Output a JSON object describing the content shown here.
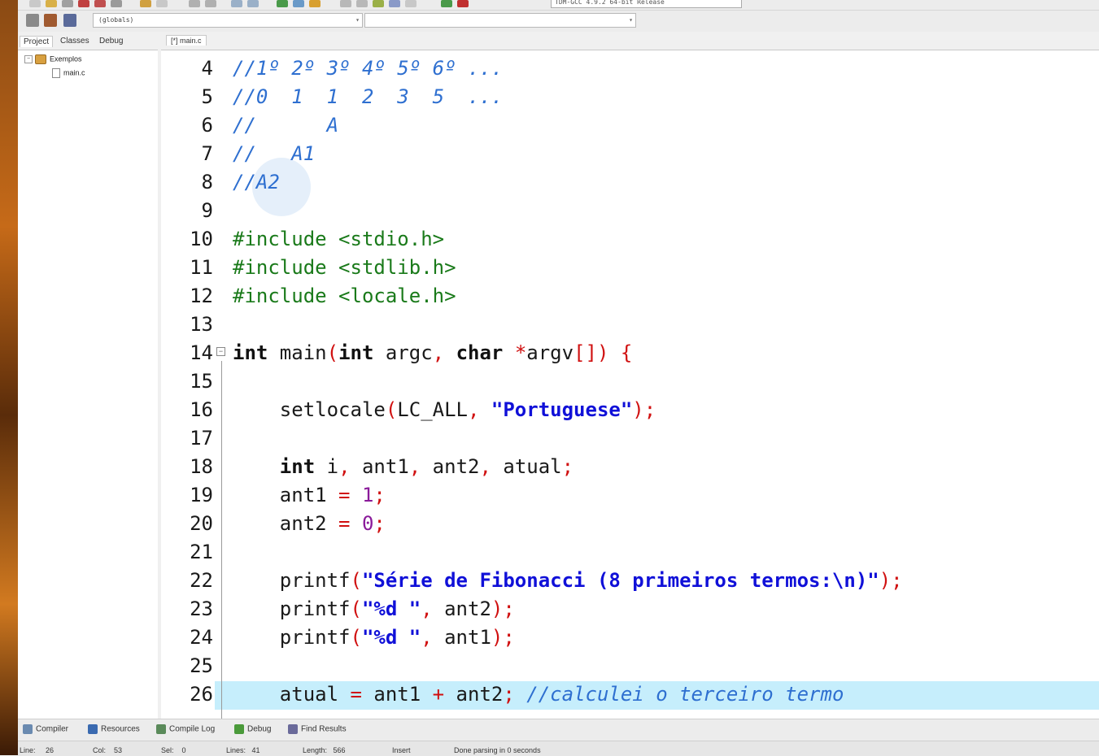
{
  "toolbar": {
    "compiler_combo": "TDM-GCC 4.9.2 64-bit Release",
    "globals_combo": "(globals)",
    "member_combo": ""
  },
  "project_panel": {
    "tabs": [
      "Project",
      "Classes",
      "Debug"
    ],
    "tree": {
      "project": "Exemplos",
      "file": "main.c"
    }
  },
  "editor": {
    "tab_label": "[*] main.c",
    "lines": [
      {
        "no": "4",
        "tokens": [
          {
            "c": "cmt",
            "t": "//1º 2º 3º 4º 5º 6º ..."
          }
        ]
      },
      {
        "no": "5",
        "tokens": [
          {
            "c": "cmt",
            "t": "//0  1  1  2  3  5  ..."
          }
        ]
      },
      {
        "no": "6",
        "tokens": [
          {
            "c": "cmt",
            "t": "//      A"
          }
        ]
      },
      {
        "no": "7",
        "tokens": [
          {
            "c": "cmt",
            "t": "//   A1"
          }
        ]
      },
      {
        "no": "8",
        "tokens": [
          {
            "c": "cmt",
            "t": "//A2"
          }
        ]
      },
      {
        "no": "9",
        "tokens": []
      },
      {
        "no": "10",
        "tokens": [
          {
            "c": "pp",
            "t": "#include <stdio.h>"
          }
        ]
      },
      {
        "no": "11",
        "tokens": [
          {
            "c": "pp",
            "t": "#include <stdlib.h>"
          }
        ]
      },
      {
        "no": "12",
        "tokens": [
          {
            "c": "pp",
            "t": "#include <locale.h>"
          }
        ]
      },
      {
        "no": "13",
        "tokens": []
      },
      {
        "no": "14",
        "tokens": [
          {
            "c": "kw",
            "t": "int"
          },
          {
            "c": "",
            "t": " main"
          },
          {
            "c": "sym",
            "t": "("
          },
          {
            "c": "kw",
            "t": "int"
          },
          {
            "c": "",
            "t": " argc"
          },
          {
            "c": "sym",
            "t": ","
          },
          {
            "c": "",
            "t": " "
          },
          {
            "c": "kw",
            "t": "char"
          },
          {
            "c": "",
            "t": " "
          },
          {
            "c": "sym",
            "t": "*"
          },
          {
            "c": "",
            "t": "argv"
          },
          {
            "c": "sym",
            "t": "[]) {"
          }
        ]
      },
      {
        "no": "15",
        "tokens": []
      },
      {
        "no": "16",
        "tokens": [
          {
            "c": "",
            "t": "    setlocale"
          },
          {
            "c": "sym",
            "t": "("
          },
          {
            "c": "",
            "t": "LC_ALL"
          },
          {
            "c": "sym",
            "t": ","
          },
          {
            "c": "",
            "t": " "
          },
          {
            "c": "str",
            "t": "\"Portuguese\""
          },
          {
            "c": "sym",
            "t": ");"
          }
        ]
      },
      {
        "no": "17",
        "tokens": []
      },
      {
        "no": "18",
        "tokens": [
          {
            "c": "",
            "t": "    "
          },
          {
            "c": "kw",
            "t": "int"
          },
          {
            "c": "",
            "t": " i"
          },
          {
            "c": "sym",
            "t": ","
          },
          {
            "c": "",
            "t": " ant1"
          },
          {
            "c": "sym",
            "t": ","
          },
          {
            "c": "",
            "t": " ant2"
          },
          {
            "c": "sym",
            "t": ","
          },
          {
            "c": "",
            "t": " atual"
          },
          {
            "c": "sym",
            "t": ";"
          }
        ]
      },
      {
        "no": "19",
        "tokens": [
          {
            "c": "",
            "t": "    ant1 "
          },
          {
            "c": "sym",
            "t": "="
          },
          {
            "c": "",
            "t": " "
          },
          {
            "c": "num",
            "t": "1"
          },
          {
            "c": "sym",
            "t": ";"
          }
        ]
      },
      {
        "no": "20",
        "tokens": [
          {
            "c": "",
            "t": "    ant2 "
          },
          {
            "c": "sym",
            "t": "="
          },
          {
            "c": "",
            "t": " "
          },
          {
            "c": "num",
            "t": "0"
          },
          {
            "c": "sym",
            "t": ";"
          }
        ]
      },
      {
        "no": "21",
        "tokens": []
      },
      {
        "no": "22",
        "tokens": [
          {
            "c": "",
            "t": "    printf"
          },
          {
            "c": "sym",
            "t": "("
          },
          {
            "c": "str",
            "t": "\"Série de Fibonacci (8 primeiros termos:\\n)\""
          },
          {
            "c": "sym",
            "t": ");"
          }
        ]
      },
      {
        "no": "23",
        "tokens": [
          {
            "c": "",
            "t": "    printf"
          },
          {
            "c": "sym",
            "t": "("
          },
          {
            "c": "str",
            "t": "\"%d \""
          },
          {
            "c": "sym",
            "t": ","
          },
          {
            "c": "",
            "t": " ant2"
          },
          {
            "c": "sym",
            "t": ");"
          }
        ]
      },
      {
        "no": "24",
        "tokens": [
          {
            "c": "",
            "t": "    printf"
          },
          {
            "c": "sym",
            "t": "("
          },
          {
            "c": "str",
            "t": "\"%d \""
          },
          {
            "c": "sym",
            "t": ","
          },
          {
            "c": "",
            "t": " ant1"
          },
          {
            "c": "sym",
            "t": ");"
          }
        ]
      },
      {
        "no": "25",
        "tokens": []
      },
      {
        "no": "26",
        "tokens": [
          {
            "c": "",
            "t": "    atual "
          },
          {
            "c": "sym",
            "t": "="
          },
          {
            "c": "",
            "t": " ant1 "
          },
          {
            "c": "sym",
            "t": "+"
          },
          {
            "c": "",
            "t": " ant2"
          },
          {
            "c": "sym",
            "t": ";"
          },
          {
            "c": "",
            "t": " "
          },
          {
            "c": "cmt",
            "t": "//calculei o terceiro termo"
          }
        ]
      }
    ],
    "highlighted_line": "26"
  },
  "bottom_tabs": [
    {
      "label": "Compiler",
      "icon": "compiler-icon",
      "color": "#6a8ab0"
    },
    {
      "label": "Resources",
      "icon": "resources-icon",
      "color": "#3a6ab0"
    },
    {
      "label": "Compile Log",
      "icon": "compile-log-icon",
      "color": "#5a8a5a"
    },
    {
      "label": "Debug",
      "icon": "debug-icon",
      "color": "#4a9a3a"
    },
    {
      "label": "Find Results",
      "icon": "find-results-icon",
      "color": "#6a6a9a"
    }
  ],
  "status": {
    "line_label": "Line:",
    "line_value": "26",
    "col_label": "Col:",
    "col_value": "53",
    "sel_label": "Sel:",
    "sel_value": "0",
    "lines_label": "Lines:",
    "lines_value": "41",
    "length_label": "Length:",
    "length_value": "566",
    "mode": "Insert",
    "message": "Done parsing in 0 seconds"
  }
}
